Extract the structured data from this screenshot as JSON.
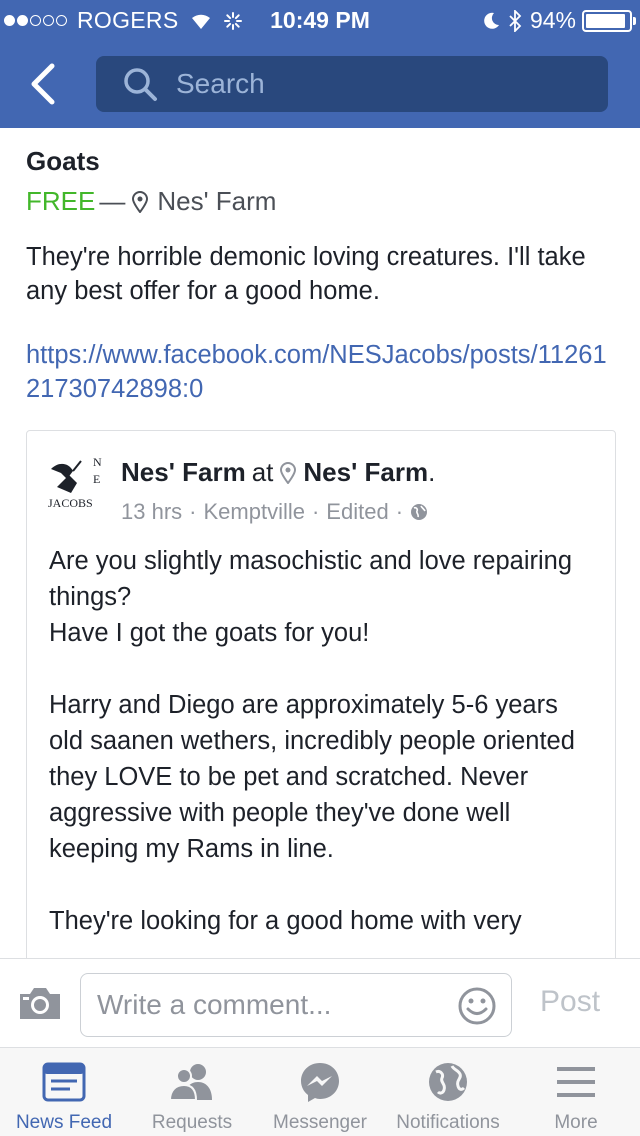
{
  "status_bar": {
    "carrier": "ROGERS",
    "time": "10:49 PM",
    "battery": "94%",
    "battery_level": 0.94
  },
  "nav": {
    "search_placeholder": "Search"
  },
  "listing": {
    "title": "Goats",
    "price": "FREE",
    "separator": "—",
    "location": "Nes' Farm",
    "description": "They're horrible demonic loving creatures. I'll take any best offer for a good home.",
    "link": "https://www.facebook.com/NESJacobs/posts/1126121730742898:0"
  },
  "shared_post": {
    "author": "Nes' Farm",
    "at": "at",
    "place": "Nes' Farm",
    "place_suffix": ".",
    "time": "13 hrs",
    "meta_sep": "·",
    "city": "Kemptville",
    "edited": "Edited",
    "avatar_text": {
      "n": "N",
      "e": "E",
      "name": "JACOBS"
    },
    "text": "Are you slightly masochistic and love repairing things?\nHave I got the goats for you!\n\nHarry and Diego are approximately 5-6 years old saanen wethers, incredibly people oriented they LOVE to be pet and scratched. Never aggressive with people they've done well keeping my Rams in line.\n\nThey're looking for a good home with very"
  },
  "comment_bar": {
    "placeholder": "Write a comment...",
    "post_label": "Post"
  },
  "tabs": [
    {
      "label": "News Feed",
      "icon": "news-feed-icon",
      "active": true
    },
    {
      "label": "Requests",
      "icon": "requests-icon",
      "active": false
    },
    {
      "label": "Messenger",
      "icon": "messenger-icon",
      "active": false
    },
    {
      "label": "Notifications",
      "icon": "globe-icon",
      "active": false
    },
    {
      "label": "More",
      "icon": "menu-icon",
      "active": false
    }
  ],
  "colors": {
    "brand": "#4267b2",
    "free": "#42b72a",
    "muted": "#90949c"
  }
}
